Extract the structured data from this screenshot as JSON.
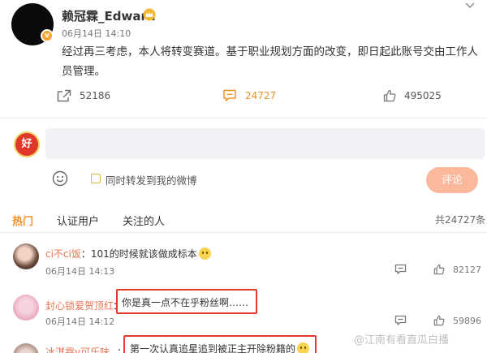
{
  "post": {
    "author": "赖冠霖_Edward",
    "date": "06月14日 14:10",
    "text": "经过再三考虑，本人将转变赛道。基于职业规划方面的改变，即日起此账号交由工作人员管理。",
    "shares": "52186",
    "comments": "24727",
    "likes": "495025"
  },
  "compose": {
    "avatar_text": "好",
    "repost_label": "同时转发到我的微博",
    "submit_label": "评论"
  },
  "tabs": {
    "hot": "热门",
    "verified": "认证用户",
    "following": "关注的人"
  },
  "total_count": "共24727条",
  "comments": [
    {
      "name": "ci不ci饭",
      "text": "101的时候就该做成标本",
      "date": "06月14日 14:13",
      "replies": "",
      "likes": "82127"
    },
    {
      "name": "封心锁爱贺顶红",
      "text": "你是真一点不在乎粉丝啊……",
      "date": "06月14日 14:12",
      "replies": "",
      "likes": "59896"
    },
    {
      "name": "冰淇霖v可乐味",
      "text": "第一次认真追星追到被正主开除粉籍的"
    }
  ],
  "watermark": "@江南有看直瓜白播",
  "colors": {
    "accent": "#f09027",
    "username": "#eb7350",
    "highlight_box": "#e33a2c"
  }
}
